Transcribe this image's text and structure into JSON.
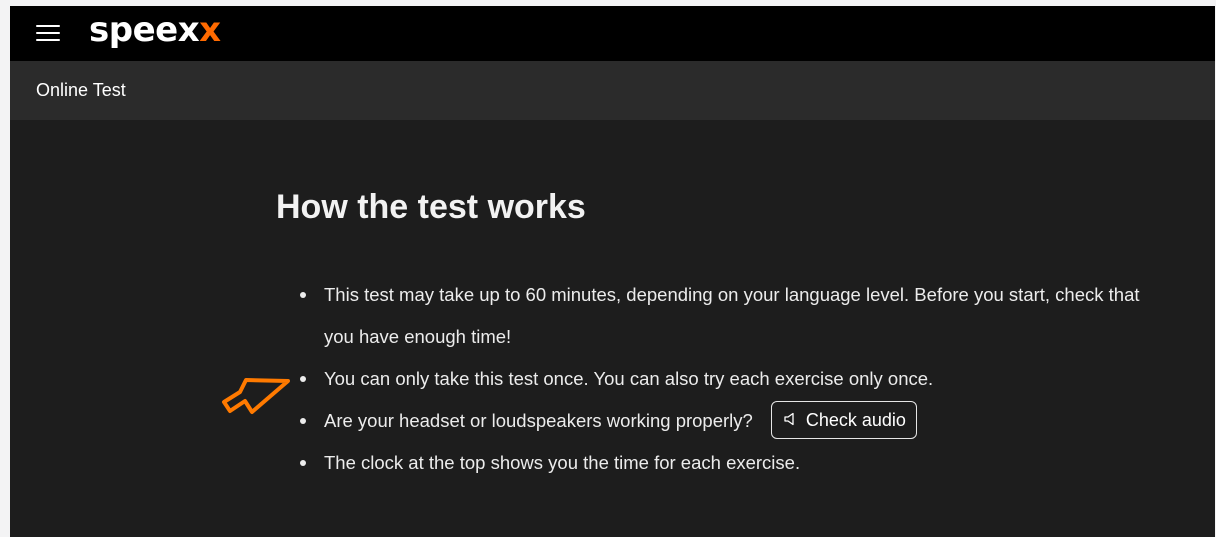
{
  "topbar": {
    "menu_icon": "hamburger-menu-icon",
    "logo": {
      "prefix": "speex",
      "accent": "x",
      "accent_color": "#ff6a00"
    }
  },
  "subbar": {
    "title": "Online Test"
  },
  "main": {
    "title": "How the test works",
    "bullets": [
      {
        "text": "This test may take up to 60 minutes, depending on your language level. Before you start, check that you have enough time!"
      },
      {
        "text": "You can only take this test once. You can also try each exercise only once."
      },
      {
        "text": "Are your headset or loudspeakers working properly?",
        "button_label": "Check audio",
        "button_icon": "speaker-icon"
      },
      {
        "text": "The clock at the top shows you the time for each exercise."
      }
    ]
  },
  "annotation": {
    "icon": "hand-drawn-arrow-icon",
    "color": "#ff7a00"
  },
  "colors": {
    "topbar_bg": "#000000",
    "subbar_bg": "#2b2b2b",
    "content_bg": "#1d1d1d"
  }
}
